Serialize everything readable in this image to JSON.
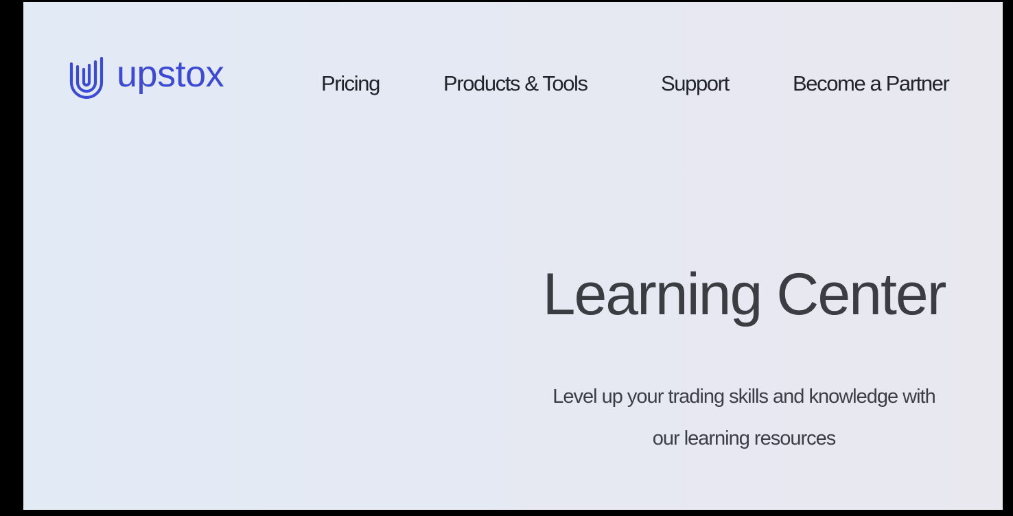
{
  "header": {
    "logo": {
      "icon": "upstox-logo-icon",
      "wordmark": "upstox",
      "color": "#3d4bd4"
    },
    "nav": [
      {
        "label": "Pricing"
      },
      {
        "label": "Products & Tools"
      },
      {
        "label": "Support"
      },
      {
        "label": "Become a Partner"
      }
    ]
  },
  "hero": {
    "title": "Learning Center",
    "subtitle_line1": "Level up your trading skills and knowledge with",
    "subtitle_line2": "our learning resources"
  },
  "colors": {
    "background_start": "#e2eaf6",
    "background_end": "#e9e8ef",
    "text": "#1f232a",
    "brand": "#3d4bd4"
  }
}
